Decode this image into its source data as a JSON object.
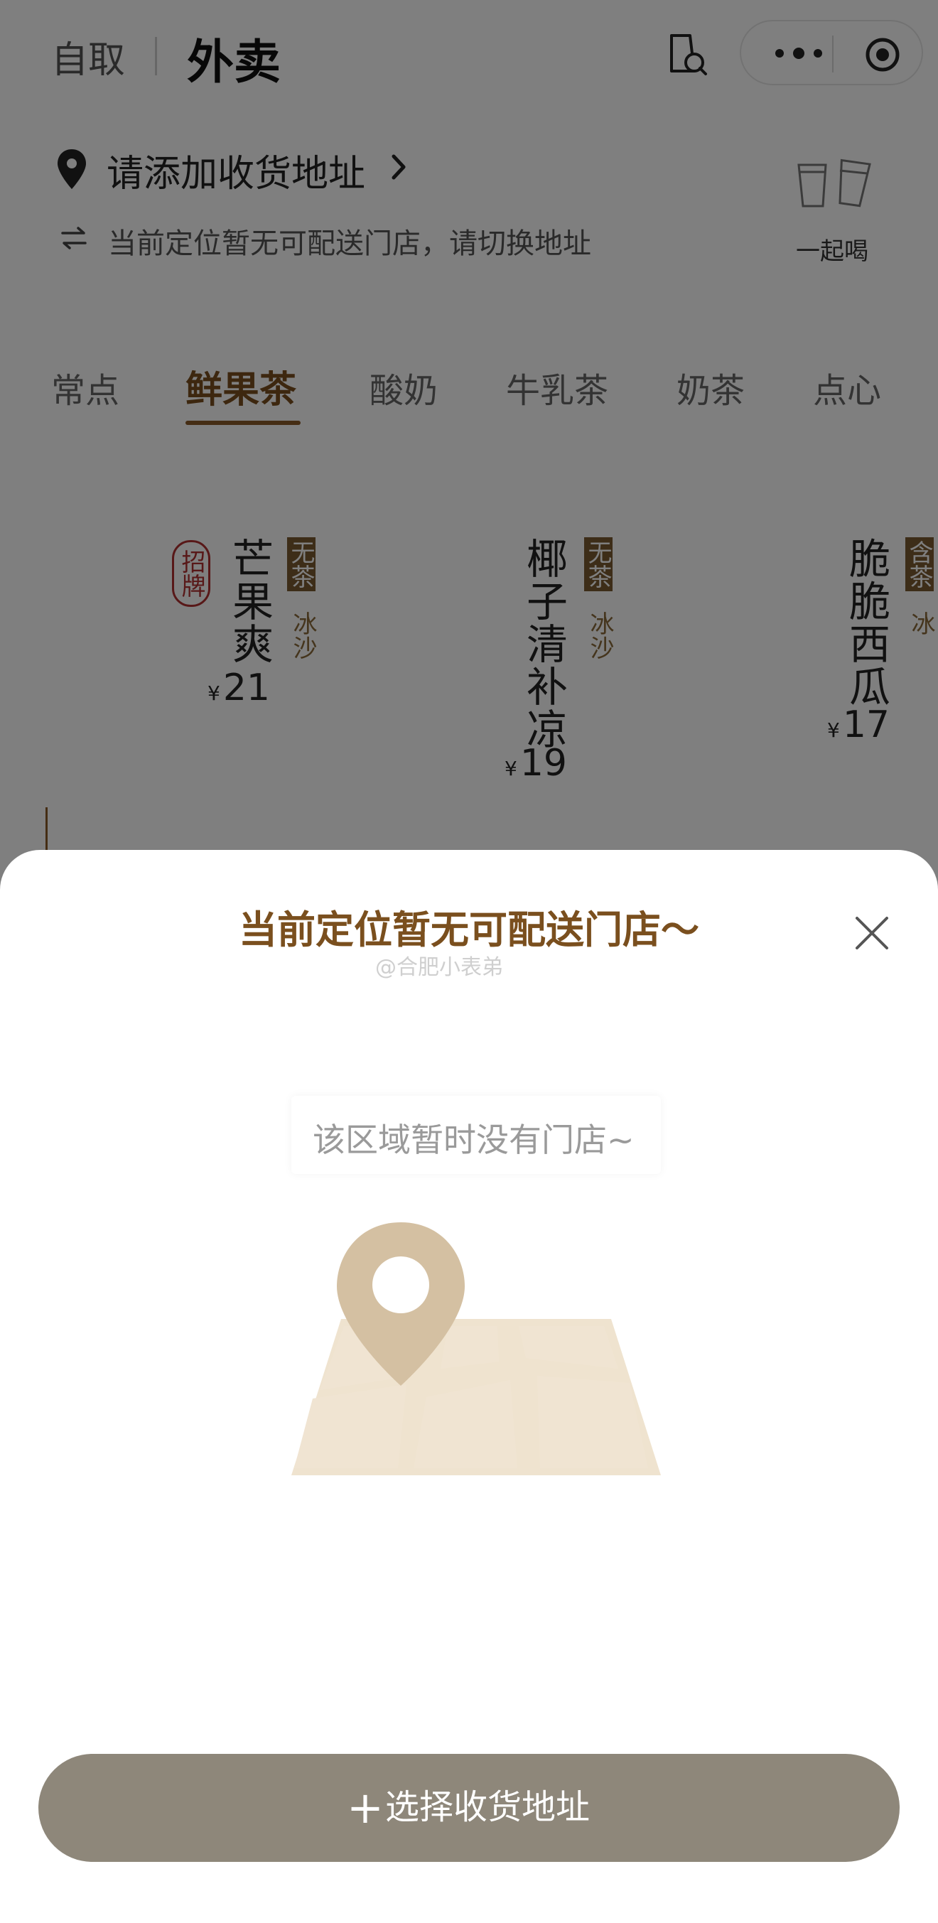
{
  "header": {
    "mode_pickup": "自取",
    "mode_delivery": "外卖",
    "menu_icon": "more-dots-icon",
    "close_icon": "target-circle-icon"
  },
  "address": {
    "prompt": "请添加收货地址",
    "hint": "当前定位暂无可配送门店，请切换地址",
    "together_label": "一起喝"
  },
  "tabs": [
    {
      "label": "常点"
    },
    {
      "label": "鲜果茶"
    },
    {
      "label": "酸奶"
    },
    {
      "label": "牛乳茶"
    },
    {
      "label": "奶茶"
    },
    {
      "label": "点心"
    }
  ],
  "active_tab": "鲜果茶",
  "products": [
    {
      "name": "芒果爽",
      "badge": "招牌",
      "tag": "无茶",
      "sub": "冰沙",
      "currency": "¥",
      "price": "21"
    },
    {
      "name": "椰子清补凉",
      "tag": "无茶",
      "sub": "冰沙",
      "currency": "¥",
      "price": "19"
    },
    {
      "name": "脆脆西瓜",
      "tag": "含茶",
      "sub": "冰",
      "currency": "¥",
      "price": "17"
    }
  ],
  "sheet": {
    "title": "当前定位暂无可配送门店～",
    "watermark": "@合肥小表弟",
    "empty_message": "该区域暂时没有门店~",
    "cta_plus": "+",
    "cta_label": "选择收货地址"
  },
  "colors": {
    "accent_brown": "#7a4f1e",
    "cta_bg": "#8e877a",
    "badge_red": "#b03030"
  }
}
